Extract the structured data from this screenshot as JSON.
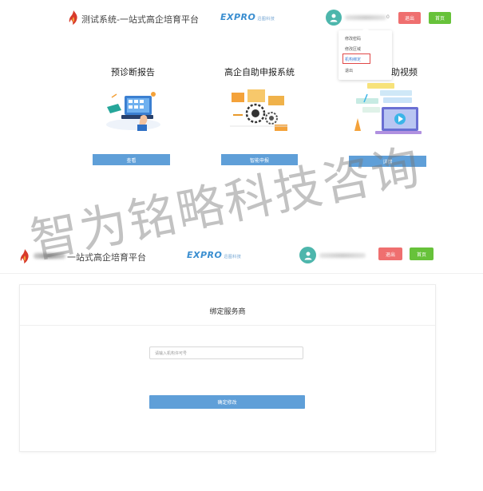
{
  "top": {
    "header": {
      "brand": "测试系统-一站式高企培育平台",
      "logo_text": "EXPRO",
      "logo_sub": "迅图科技",
      "user_suffix": "0",
      "logout": "退出",
      "home": "首页"
    },
    "dropdown": {
      "items": [
        "修改密码",
        "修改区域",
        "机构绑定",
        "退出"
      ],
      "highlighted": "机构绑定"
    },
    "features": [
      {
        "title": "预诊断报告",
        "button": "查看"
      },
      {
        "title": "高企自助申报系统",
        "button": "智能申报"
      },
      {
        "title": "助视频",
        "button": "详情"
      }
    ]
  },
  "watermark": "智为铭略科技咨询",
  "bottom": {
    "header": {
      "brand": "一站式高企培育平台",
      "logo_text": "EXPRO",
      "logo_sub": "迅图科技",
      "logout": "退出",
      "home": "首页"
    },
    "card": {
      "title": "绑定服务商",
      "input_placeholder": "请输入机构许可号",
      "confirm": "确定修改"
    }
  },
  "colors": {
    "accent_blue": "#5f9fd8",
    "logout_red": "#ef6f6f",
    "home_green": "#67c23a",
    "avatar_teal": "#4db6ac",
    "highlight_red": "#e04848"
  }
}
